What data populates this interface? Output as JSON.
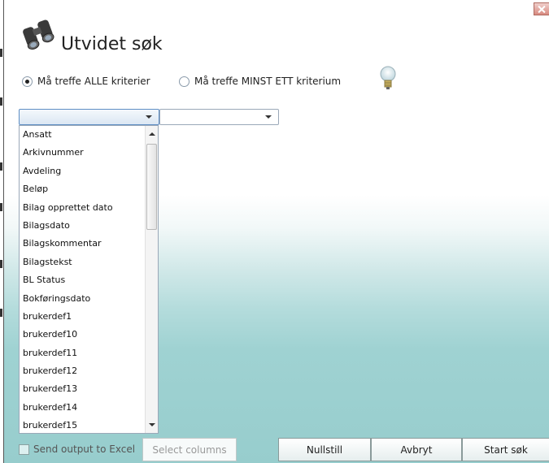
{
  "dialog": {
    "title": "Utvidet søk"
  },
  "options": {
    "match_all_label": "Må treffe ALLE kriterier",
    "match_any_label": "Må treffe MINST ETT kriterium",
    "selected": "match_all"
  },
  "field_selector": {
    "value": "",
    "items": [
      "Ansatt",
      "Arkivnummer",
      "Avdeling",
      "Beløp",
      "Bilag opprettet dato",
      "Bilagsdato",
      "Bilagskommentar",
      "Bilagstekst",
      "BL Status",
      "Bokføringsdato",
      "brukerdef1",
      "brukerdef10",
      "brukerdef11",
      "brukerdef12",
      "brukerdef13",
      "brukerdef14",
      "brukerdef15"
    ]
  },
  "operator_selector": {
    "value": ""
  },
  "footer": {
    "excel_label": "Send output to Excel",
    "select_columns_label": "Select columns",
    "reset_label": "Nullstill",
    "cancel_label": "Avbryt",
    "start_label": "Start søk"
  },
  "icons": {
    "title": "binoculars-icon",
    "hint": "lightbulb-icon",
    "close": "close-icon"
  }
}
